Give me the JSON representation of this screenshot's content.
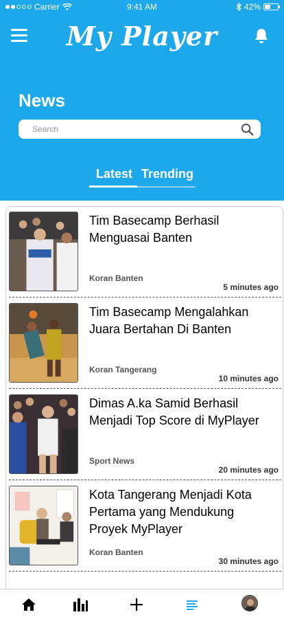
{
  "status_bar": {
    "carrier": "Carrier",
    "time": "9:41 AM",
    "battery": "42%",
    "battery_level": 0.42
  },
  "header": {
    "app_title": "My Player",
    "section_title": "News"
  },
  "search": {
    "placeholder": "Search"
  },
  "tabs": [
    {
      "label": "Latest",
      "active": true
    },
    {
      "label": "Trending",
      "active": false
    }
  ],
  "news": [
    {
      "title": "Tim Basecamp Berhasil Menguasai Banten",
      "source": "Koran Banten",
      "time": "5 minutes ago"
    },
    {
      "title": "Tim Basecamp Mengalahkan Juara Bertahan Di Banten",
      "source": "Koran Tangerang",
      "time": "10 minutes ago"
    },
    {
      "title": "Dimas A.ka Samid Berhasil Menjadi Top Score di MyPlayer",
      "source": "Sport News",
      "time": "20 minutes ago"
    },
    {
      "title": "Kota Tangerang Menjadi Kota Pertama yang Mendukung Proyek MyPlayer",
      "source": "Koran Banten",
      "time": "30 minutes ago"
    }
  ],
  "bottom_nav": [
    {
      "icon": "home-icon"
    },
    {
      "icon": "stats-icon"
    },
    {
      "icon": "plus-icon"
    },
    {
      "icon": "news-icon",
      "active": true
    },
    {
      "icon": "profile-avatar"
    }
  ],
  "colors": {
    "primary": "#1ea8ec",
    "active_nav": "#1ea8ec",
    "text": "#000000"
  }
}
